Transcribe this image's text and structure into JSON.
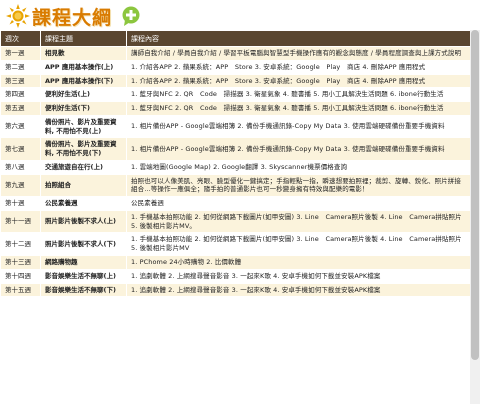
{
  "header": {
    "title": "課程大綱",
    "sun_icon": "sun-icon",
    "bubble_icon": "speech-bubble-icon"
  },
  "table": {
    "columns": [
      "週次",
      "課程主題",
      "課程內容"
    ],
    "rows": [
      {
        "week": "第一週",
        "topic": "相見歡",
        "content": "講師自我介紹 / 學員自我介紹 / 學習平板電腦與智慧型手機操作應有的觀念與態度 / 學員程度調查與上課方式說明"
      },
      {
        "week": "第二週",
        "topic": "APP 應用基本操作(上)",
        "content": "1. 介紹各APP 2. 蘋果系統：APP　Store 3. 安卓系統：Google　Play　商店 4. 刪除APP 應用程式"
      },
      {
        "week": "第三週",
        "topic": "APP 應用基本操作(下)",
        "content": "1. 介紹各APP 2. 蘋果系統：APP　Store 3. 安卓系統：Google　Play　商店 4. 刪除APP 應用程式"
      },
      {
        "week": "第四週",
        "topic": "便利好生活(上)",
        "content": "1. 藍牙與NFC 2. QR　Code　掃描器 3. 衛星氣象 4. 聽書播 5. 用小工具解決生活問題 6. ibone行動生活"
      },
      {
        "week": "第五週",
        "topic": "便利好生活(下)",
        "content": "1. 藍牙與NFC 2. QR　Code　掃描器 3. 衛星氣象 4. 聽書播 5. 用小工具解決生活問題 6. ibone行動生活"
      },
      {
        "week": "第六週",
        "topic": "備份照片、影片及重要資料, 不用怕不見(上)",
        "content": "1. 相片備份APP - Google雲端相簿 2. 備份手機通訊錄-Copy My Data 3. 使用雲端硬碟備份重要手機資料"
      },
      {
        "week": "第七週",
        "topic": "備份照片、影片及重要資料, 不用怕不見(下)",
        "content": "1. 相片備份APP - Google雲端相簿 2. 備份手機通訊錄-Copy My Data 3. 使用雲端硬碟備份重要手機資料"
      },
      {
        "week": "第八週",
        "topic": "交通旅遊自在行(上)",
        "content": "1. 雲端地圖(Google Map) 2. Google翻譯 3. Skyscanner機票價格查詢"
      },
      {
        "week": "第九週",
        "topic": "拍照組合",
        "content": "拍照也可以人像美肌、亮眼、臉型優化一鍵搞定；手指輕點一指，瞬速想要拍照裡；裁剪、旋轉、銳化、照片拼接組合…等操作一應俱全；隨手拍的普通影片也可一秒變身擁有特效與配樂的電影！"
      },
      {
        "week": "第十週",
        "topic": "公民素養週",
        "content": "公民素養週"
      },
      {
        "week": "第十一週",
        "topic": "照片影片後製不求人(上)",
        "content": "1. 手機基本拍照功能 2. 如何從網路下載圖片(如甲安圖) 3. Line　Camera照片後製 4. Line　Camera拼貼照片 5. 後製相片影片MV。"
      },
      {
        "week": "第十二週",
        "topic": "照片影片後製不求人(下)",
        "content": "1. 手機基本拍照功能 2. 如何從網路下載圖片(如甲安圖) 3. Line　Camera照片後製 4. Line　Camera拼貼照片 5. 後製相片影片MV"
      },
      {
        "week": "第十三週",
        "topic": "網路購物趣",
        "content": "1. PChome 24小時購物 2. 比價軟體"
      },
      {
        "week": "第十四週",
        "topic": "影音娛樂生活不無聊(上)",
        "content": "1. 追劇軟體 2. 上網搜尋聲音影音 3. 一起來K歌 4. 安卓手機如何下載並安裝APK檔案"
      },
      {
        "week": "第十五週",
        "topic": "影音娛樂生活不無聊(下)",
        "content": "1. 追劇軟體 2. 上網搜尋聲音影音 3. 一起來K歌 4. 安卓手機如何下載並安裝APK檔案"
      }
    ]
  }
}
